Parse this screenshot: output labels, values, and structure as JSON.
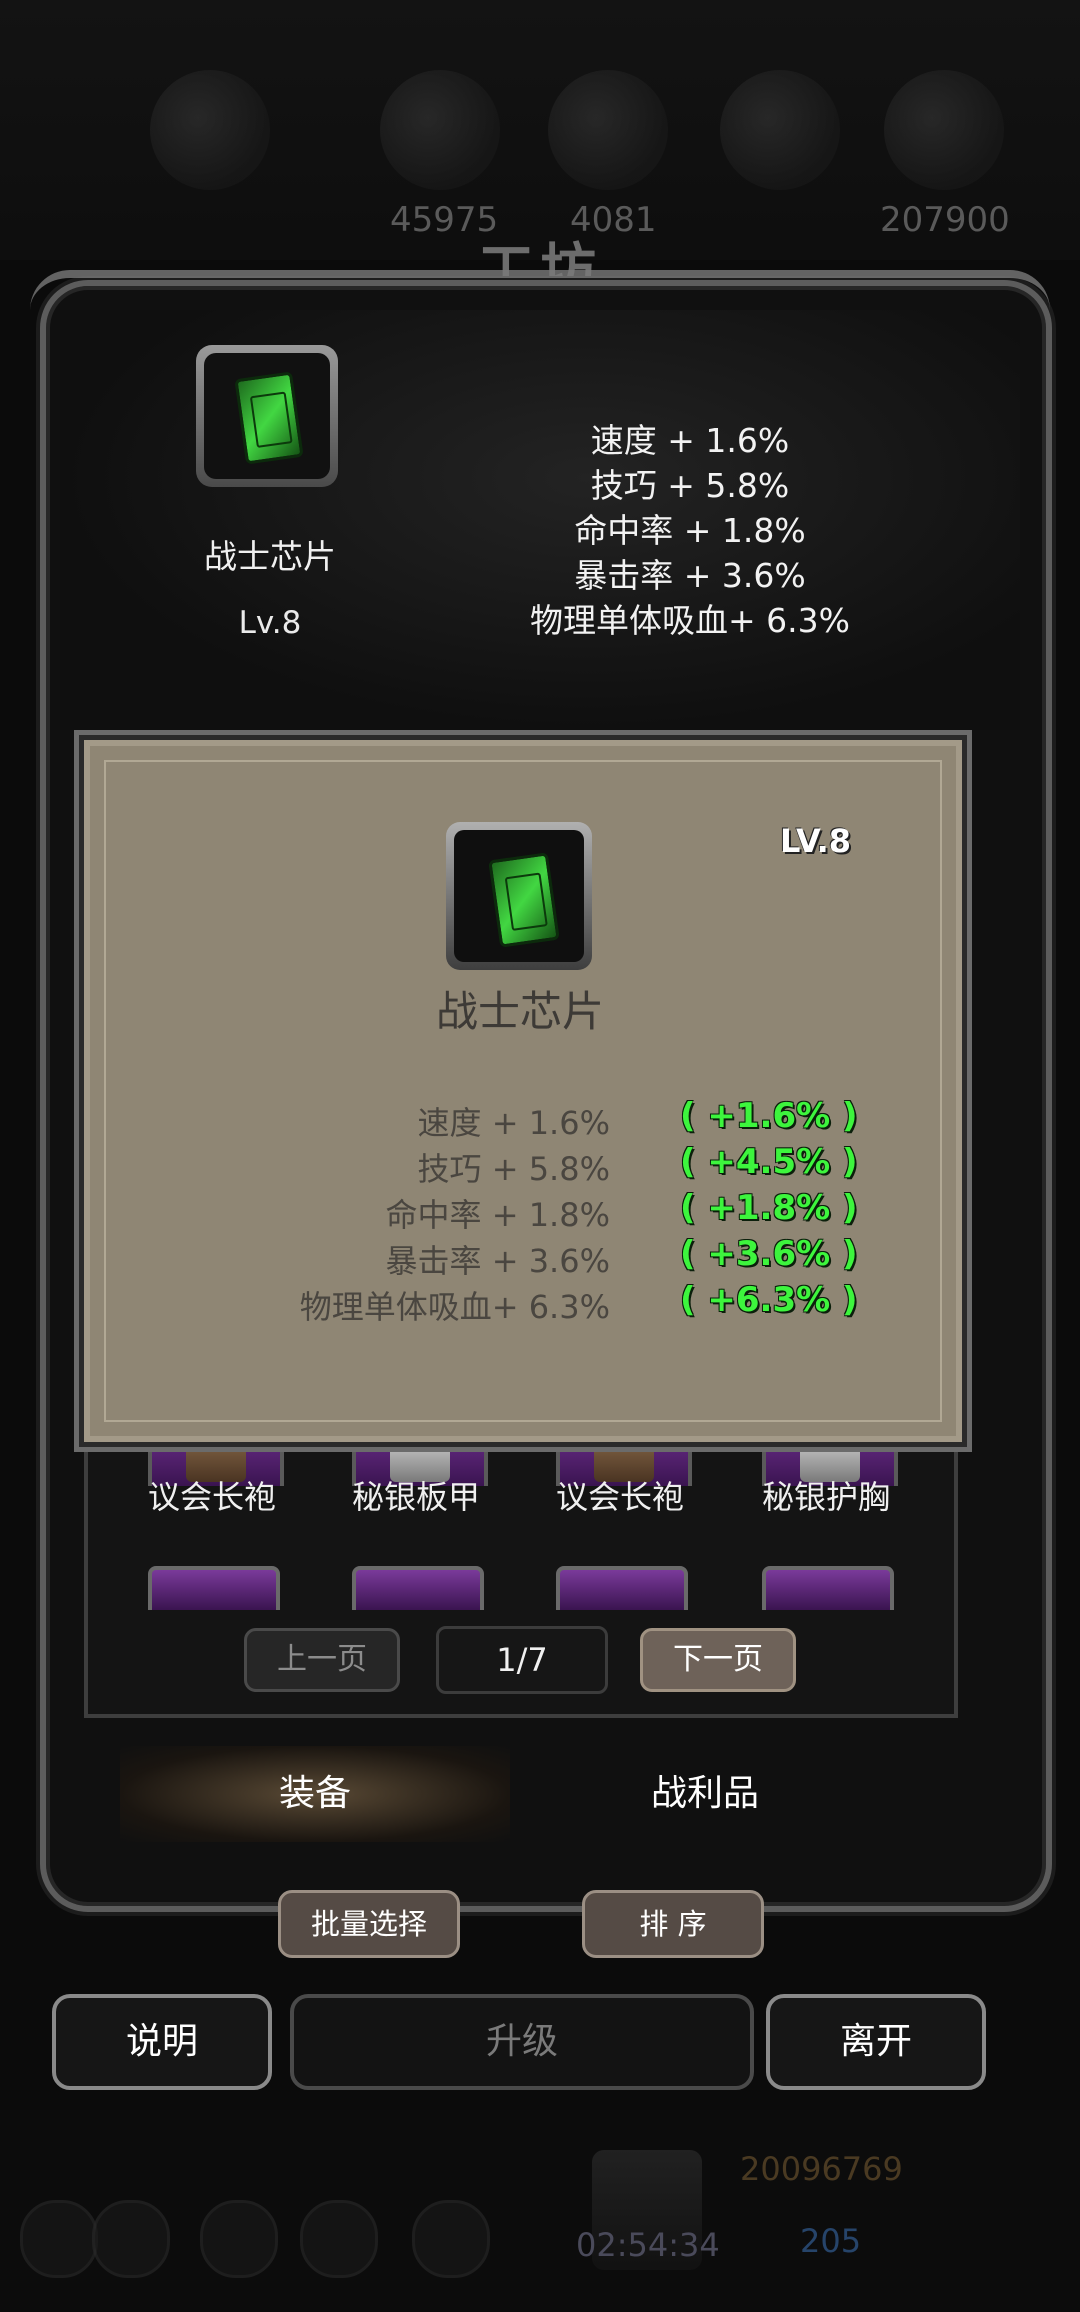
{
  "background": {
    "resources": [
      "45975",
      "4081",
      "207900"
    ],
    "title": "工坊",
    "currency_gold": "20096769",
    "currency_blue": "205",
    "timer": "02:54:34"
  },
  "item": {
    "name": "战士芯片",
    "level_short": "Lv.8",
    "level_caps": "LV.8",
    "icon": "chip-icon",
    "stats": [
      {
        "text": "速度 + 1.6%",
        "bonus": "( +1.6% )"
      },
      {
        "text": "技巧 + 5.8%",
        "bonus": "( +4.5% )"
      },
      {
        "text": "命中率 + 1.8%",
        "bonus": "( +1.8% )"
      },
      {
        "text": "暴击率 + 3.6%",
        "bonus": "( +3.6% )"
      },
      {
        "text": "物理单体吸血+ 6.3%",
        "bonus": "( +6.3% )"
      }
    ],
    "bonus_color": "#3df53d"
  },
  "inventory": {
    "items": [
      "议会长袍",
      "秘银板甲",
      "议会长袍",
      "秘银护胸"
    ],
    "prev_label": "上一页",
    "next_label": "下一页",
    "page": "1/7"
  },
  "tabs": {
    "equip": "装备",
    "loot": "战利品"
  },
  "actions": {
    "batch_select": "批量选择",
    "sort": "排 序",
    "help": "说明",
    "upgrade": "升级",
    "leave": "离开"
  }
}
